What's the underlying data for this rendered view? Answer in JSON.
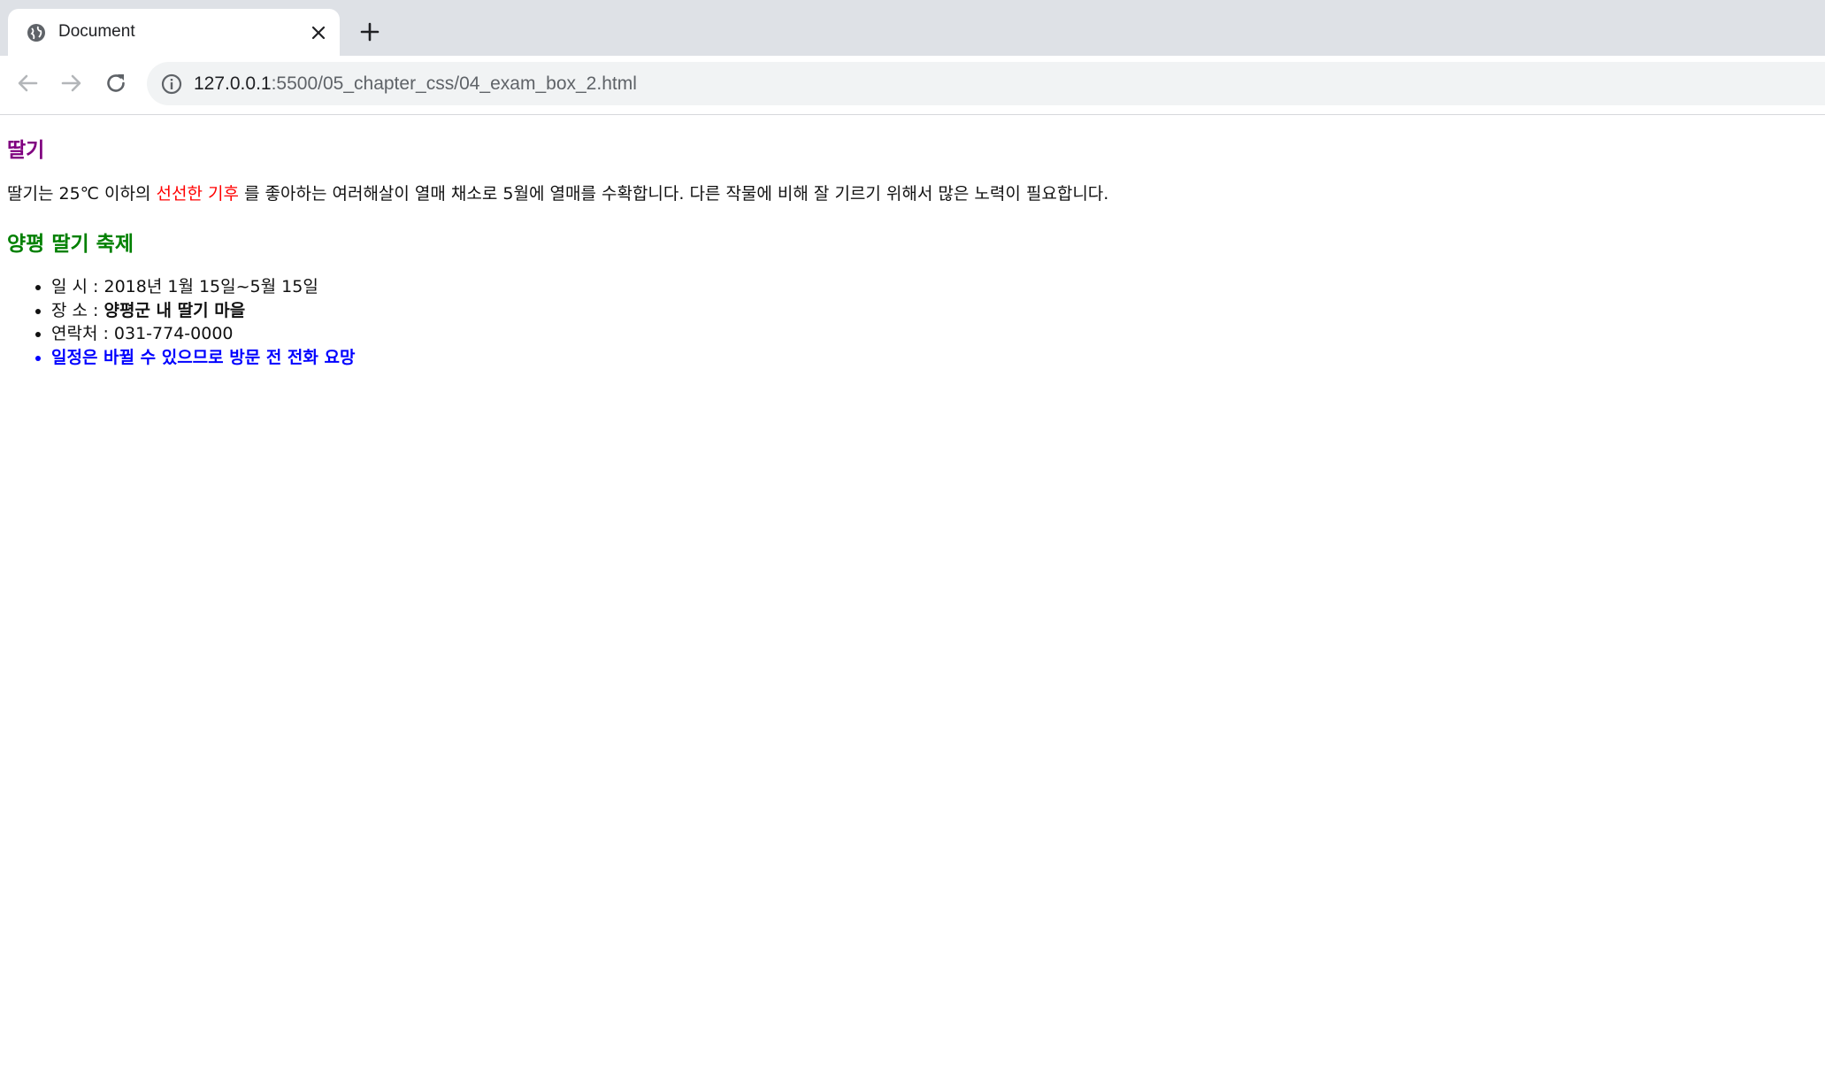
{
  "browser": {
    "tab": {
      "title": "Document",
      "icon": "globe-icon"
    },
    "new_tab_icon": "plus-icon",
    "address": {
      "host": "127.0.0.1",
      "path": ":5500/05_chapter_css/04_exam_box_2.html"
    }
  },
  "page": {
    "heading1": "딸기",
    "intro": {
      "before": "딸기는 25℃ 이하의 ",
      "highlight": "선선한 기후",
      "after": " 를 좋아하는 여러해살이 열매 채소로 5월에 열매를 수확합니다. 다른 작물에 비해 잘 기르기 위해서 많은 노력이 필요합니다."
    },
    "heading2": "양평 딸기 축제",
    "items": [
      {
        "label": "일 시 : ",
        "value": "2018년 1월 15일~5월 15일"
      },
      {
        "label": "장 소 : ",
        "value": "양평군 내 딸기 마을"
      },
      {
        "label": "연락처 : ",
        "value": "031-774-0000"
      },
      {
        "notice": "일정은 바뀔 수 있으므로 방문 전 전화 요망"
      }
    ]
  },
  "colors": {
    "heading1": "#800080",
    "heading2": "#008000",
    "highlight": "#ff0000",
    "notice": "#0000ff"
  }
}
